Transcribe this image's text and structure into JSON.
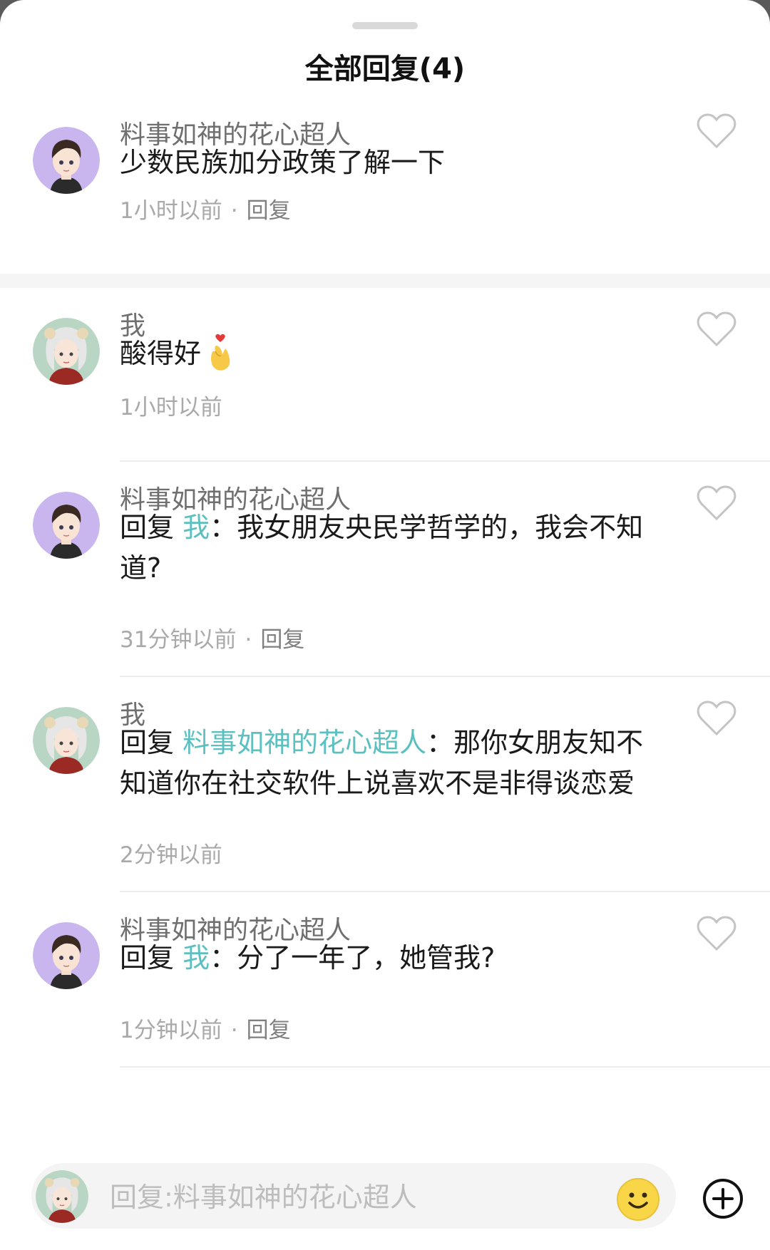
{
  "sheet": {
    "title": "全部回复(4)"
  },
  "root_comment": {
    "author": "料事如神的花心超人",
    "text": "少数民族加分政策了解一下",
    "time": "1小时以前",
    "reply_label": "回复"
  },
  "replies": [
    {
      "author": "我",
      "text": "酸得好",
      "emoji": "finger-heart",
      "time": "1小时以前"
    },
    {
      "author": "料事如神的花心超人",
      "reply_prefix": "回复",
      "mention": "我",
      "text": "：我女朋友央民学哲学的，我会不知道?",
      "time": "31分钟以前",
      "reply_label": "回复"
    },
    {
      "author": "我",
      "reply_prefix": "回复",
      "mention": "料事如神的花心超人",
      "text": "：那你女朋友知不知道你在社交软件上说喜欢不是非得谈恋爱",
      "time": "2分钟以前"
    },
    {
      "author": "料事如神的花心超人",
      "reply_prefix": "回复",
      "mention": "我",
      "text": "：分了一年了，她管我?",
      "time": "1分钟以前",
      "reply_label": "回复"
    }
  ],
  "composer": {
    "placeholder": "回复:料事如神的花心超人"
  },
  "icons": {
    "like": "heart-outline-icon",
    "emoji": "smiley-icon",
    "more": "plus-circle-icon"
  },
  "colors": {
    "mention": "#5cc0c0",
    "avatar_boy_bg": "#c9b6ee",
    "avatar_girl_bg": "#b9d6c4"
  }
}
